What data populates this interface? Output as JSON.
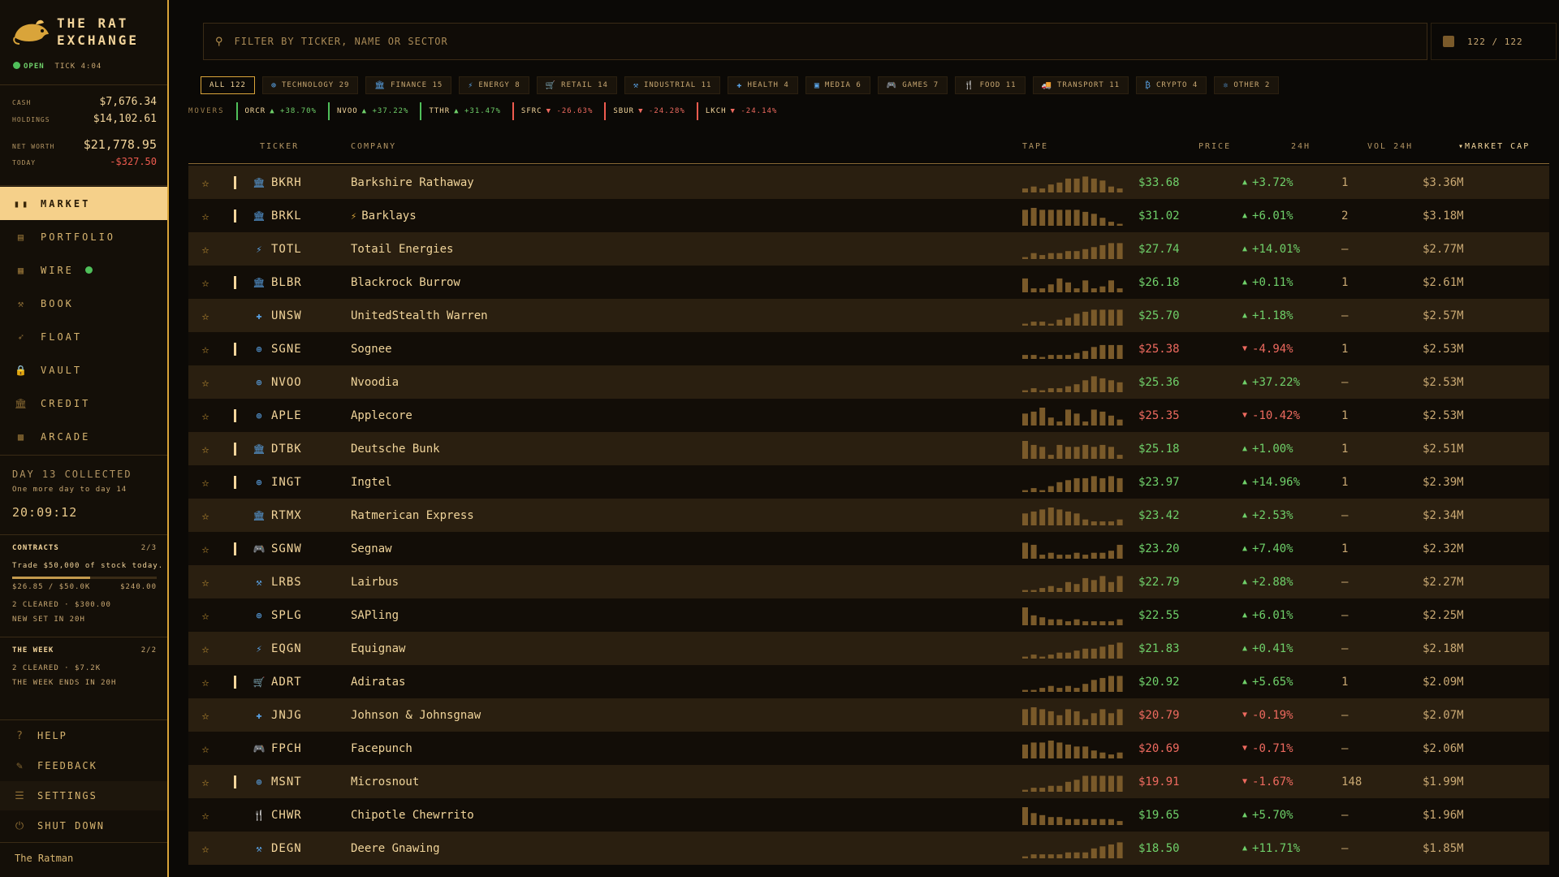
{
  "app": {
    "name_line1": "THE RAT",
    "name_line2": "EXCHANGE",
    "status": "OPEN",
    "tick": "TICK 4:04"
  },
  "account": {
    "cash_label": "CASH",
    "cash": "$7,676.34",
    "holdings_label": "HOLDINGS",
    "holdings": "$14,102.61",
    "net_worth_label": "NET WORTH",
    "net_worth": "$21,778.95",
    "today_label": "TODAY",
    "today": "-$327.50"
  },
  "nav": [
    {
      "label": "MARKET",
      "icon": "market-icon"
    },
    {
      "label": "PORTFOLIO",
      "icon": "portfolio-icon"
    },
    {
      "label": "WIRE",
      "icon": "wire-icon"
    },
    {
      "label": "BOOK",
      "icon": "gavel-icon"
    },
    {
      "label": "FLOAT",
      "icon": "rocket-icon"
    },
    {
      "label": "VAULT",
      "icon": "lock-icon"
    },
    {
      "label": "CREDIT",
      "icon": "bank-icon"
    },
    {
      "label": "ARCADE",
      "icon": "arcade-icon"
    }
  ],
  "daily": {
    "title": "DAY 13 COLLECTED",
    "subtitle": "One more day to day 14",
    "timer": "20:09:12"
  },
  "contracts": {
    "label": "CONTRACTS",
    "count": "2/3",
    "task": "Trade $50,000 of stock today.",
    "progress_text": "$26.85 / $50.0K",
    "reward": "$240.00",
    "progress": 0.537,
    "cleared": "2 CLEARED · $300.00",
    "new_set": "NEW SET IN 20H"
  },
  "week": {
    "label": "THE WEEK",
    "count": "2/2",
    "cleared": "2 CLEARED · $7.2K",
    "ends": "THE WEEK ENDS IN 20H"
  },
  "bottom_nav": [
    {
      "label": "HELP",
      "icon": "help-icon"
    },
    {
      "label": "FEEDBACK",
      "icon": "feedback-icon"
    },
    {
      "label": "SETTINGS",
      "icon": "settings-icon"
    },
    {
      "label": "SHUT DOWN",
      "icon": "power-icon"
    }
  ],
  "user": "The Ratman",
  "search": {
    "placeholder": "FILTER BY TICKER, NAME OR SECTOR",
    "count": "122 / 122"
  },
  "sectors": [
    {
      "label": "ALL 122",
      "icon": "",
      "active": true
    },
    {
      "label": "TECHNOLOGY 29",
      "icon": "⊕"
    },
    {
      "label": "FINANCE 15",
      "icon": "🏛"
    },
    {
      "label": "ENERGY 8",
      "icon": "⚡"
    },
    {
      "label": "RETAIL 14",
      "icon": "🛒"
    },
    {
      "label": "INDUSTRIAL 11",
      "icon": "⚒"
    },
    {
      "label": "HEALTH 4",
      "icon": "✚"
    },
    {
      "label": "MEDIA 6",
      "icon": "▣"
    },
    {
      "label": "GAMES 7",
      "icon": "🎮"
    },
    {
      "label": "FOOD 11",
      "icon": "🍴"
    },
    {
      "label": "TRANSPORT 11",
      "icon": "🚚"
    },
    {
      "label": "CRYPTO 4",
      "icon": "₿"
    },
    {
      "label": "OTHER 2",
      "icon": "⚛"
    }
  ],
  "movers_label": "MOVERS",
  "movers": [
    {
      "ticker": "ORCR",
      "change": "+38.70%",
      "dir": "up"
    },
    {
      "ticker": "NVOO",
      "change": "+37.22%",
      "dir": "up"
    },
    {
      "ticker": "TTHR",
      "change": "+31.47%",
      "dir": "up"
    },
    {
      "ticker": "SFRC",
      "change": "-26.63%",
      "dir": "down"
    },
    {
      "ticker": "SBUR",
      "change": "-24.28%",
      "dir": "down"
    },
    {
      "ticker": "LKCH",
      "change": "-24.14%",
      "dir": "down"
    }
  ],
  "columns": {
    "ticker": "TICKER",
    "company": "COMPANY",
    "tape": "TAPE",
    "price": "PRICE",
    "change": "24H",
    "volume": "VOL 24H",
    "market_cap": "▾MARKET CAP"
  },
  "stocks": [
    {
      "ticker": "BKRH",
      "company": "Barkshire Rathaway",
      "held": true,
      "sector_icon": "🏛",
      "price": "$33.68",
      "change": "+3.72%",
      "dir": "up",
      "vol": "1",
      "cap": "$3.36M",
      "tape": [
        2,
        3,
        2,
        4,
        5,
        7,
        7,
        8,
        7,
        6,
        3,
        2
      ]
    },
    {
      "ticker": "BRKL",
      "company": "Barklays",
      "held": true,
      "sector_icon": "🏛",
      "inline_icon": "⚡",
      "price": "$31.02",
      "change": "+6.01%",
      "dir": "up",
      "vol": "2",
      "cap": "$3.18M",
      "tape": [
        8,
        9,
        8,
        8,
        8,
        8,
        8,
        7,
        6,
        4,
        2,
        1
      ]
    },
    {
      "ticker": "TOTL",
      "company": "Totail Energies",
      "held": false,
      "sector_icon": "⚡",
      "price": "$27.74",
      "change": "+14.01%",
      "dir": "up",
      "vol": "—",
      "cap": "$2.77M",
      "tape": [
        1,
        3,
        2,
        3,
        3,
        4,
        4,
        5,
        6,
        7,
        8,
        8
      ]
    },
    {
      "ticker": "BLBR",
      "company": "Blackrock Burrow",
      "held": true,
      "sector_icon": "🏛",
      "price": "$26.18",
      "change": "+0.11%",
      "dir": "up",
      "vol": "1",
      "cap": "$2.61M",
      "tape": [
        7,
        2,
        2,
        4,
        7,
        5,
        2,
        6,
        2,
        3,
        6,
        2
      ]
    },
    {
      "ticker": "UNSW",
      "company": "UnitedStealth Warren",
      "held": false,
      "sector_icon": "✚",
      "price": "$25.70",
      "change": "+1.18%",
      "dir": "up",
      "vol": "—",
      "cap": "$2.57M",
      "tape": [
        1,
        2,
        2,
        1,
        3,
        4,
        6,
        7,
        8,
        8,
        8,
        8
      ]
    },
    {
      "ticker": "SGNE",
      "company": "Sognee",
      "held": true,
      "sector_icon": "⊕",
      "price": "$25.38",
      "change": "-4.94%",
      "dir": "down",
      "vol": "1",
      "cap": "$2.53M",
      "tape": [
        2,
        2,
        1,
        2,
        2,
        2,
        3,
        4,
        6,
        7,
        7,
        7
      ]
    },
    {
      "ticker": "NVOO",
      "company": "Nvoodia",
      "held": false,
      "sector_icon": "⊕",
      "price": "$25.36",
      "change": "+37.22%",
      "dir": "up",
      "vol": "—",
      "cap": "$2.53M",
      "tape": [
        1,
        2,
        1,
        2,
        2,
        3,
        4,
        6,
        8,
        7,
        6,
        5
      ]
    },
    {
      "ticker": "APLE",
      "company": "Applecore",
      "held": true,
      "sector_icon": "⊕",
      "price": "$25.35",
      "change": "-10.42%",
      "dir": "down",
      "vol": "1",
      "cap": "$2.53M",
      "tape": [
        6,
        7,
        9,
        4,
        2,
        8,
        6,
        2,
        8,
        7,
        5,
        3
      ]
    },
    {
      "ticker": "DTBK",
      "company": "Deutsche Bunk",
      "held": true,
      "sector_icon": "🏛",
      "price": "$25.18",
      "change": "+1.00%",
      "dir": "up",
      "vol": "1",
      "cap": "$2.51M",
      "tape": [
        9,
        7,
        6,
        2,
        7,
        6,
        6,
        7,
        6,
        7,
        6,
        2
      ]
    },
    {
      "ticker": "INGT",
      "company": "Ingtel",
      "held": true,
      "sector_icon": "⊕",
      "price": "$23.97",
      "change": "+14.96%",
      "dir": "up",
      "vol": "1",
      "cap": "$2.39M",
      "tape": [
        1,
        2,
        1,
        3,
        5,
        6,
        7,
        7,
        8,
        7,
        8,
        7
      ]
    },
    {
      "ticker": "RTMX",
      "company": "Ratmerican Express",
      "held": false,
      "sector_icon": "🏛",
      "price": "$23.42",
      "change": "+2.53%",
      "dir": "up",
      "vol": "—",
      "cap": "$2.34M",
      "tape": [
        6,
        7,
        8,
        9,
        8,
        7,
        6,
        3,
        2,
        2,
        2,
        3
      ]
    },
    {
      "ticker": "SGNW",
      "company": "Segnaw",
      "held": true,
      "sector_icon": "🎮",
      "price": "$23.20",
      "change": "+7.40%",
      "dir": "up",
      "vol": "1",
      "cap": "$2.32M",
      "tape": [
        8,
        7,
        2,
        3,
        2,
        2,
        3,
        2,
        3,
        3,
        4,
        7
      ]
    },
    {
      "ticker": "LRBS",
      "company": "Lairbus",
      "held": false,
      "sector_icon": "⚒",
      "price": "$22.79",
      "change": "+2.88%",
      "dir": "up",
      "vol": "—",
      "cap": "$2.27M",
      "tape": [
        1,
        1,
        2,
        3,
        2,
        5,
        4,
        7,
        6,
        8,
        5,
        8
      ]
    },
    {
      "ticker": "SPLG",
      "company": "SAPling",
      "held": false,
      "sector_icon": "⊕",
      "price": "$22.55",
      "change": "+6.01%",
      "dir": "up",
      "vol": "—",
      "cap": "$2.25M",
      "tape": [
        9,
        5,
        4,
        3,
        3,
        2,
        3,
        2,
        2,
        2,
        2,
        3
      ]
    },
    {
      "ticker": "EQGN",
      "company": "Equignaw",
      "held": false,
      "sector_icon": "⚡",
      "price": "$21.83",
      "change": "+0.41%",
      "dir": "up",
      "vol": "—",
      "cap": "$2.18M",
      "tape": [
        1,
        2,
        1,
        2,
        3,
        3,
        4,
        5,
        5,
        6,
        7,
        8
      ]
    },
    {
      "ticker": "ADRT",
      "company": "Adiratas",
      "held": true,
      "sector_icon": "🛒",
      "price": "$20.92",
      "change": "+5.65%",
      "dir": "up",
      "vol": "1",
      "cap": "$2.09M",
      "tape": [
        1,
        1,
        2,
        3,
        2,
        3,
        2,
        4,
        6,
        7,
        8,
        8
      ]
    },
    {
      "ticker": "JNJG",
      "company": "Johnson & Johnsgnaw",
      "held": false,
      "sector_icon": "✚",
      "price": "$20.79",
      "change": "-0.19%",
      "dir": "down",
      "vol": "—",
      "cap": "$2.07M",
      "tape": [
        8,
        9,
        8,
        7,
        5,
        8,
        7,
        3,
        6,
        8,
        6,
        8
      ]
    },
    {
      "ticker": "FPCH",
      "company": "Facepunch",
      "held": false,
      "sector_icon": "🎮",
      "price": "$20.69",
      "change": "-0.71%",
      "dir": "down",
      "vol": "—",
      "cap": "$2.06M",
      "tape": [
        7,
        8,
        8,
        9,
        8,
        7,
        6,
        6,
        4,
        3,
        2,
        3
      ]
    },
    {
      "ticker": "MSNT",
      "company": "Microsnout",
      "held": true,
      "sector_icon": "⊕",
      "price": "$19.91",
      "change": "-1.67%",
      "dir": "down",
      "vol": "148",
      "cap": "$1.99M",
      "tape": [
        1,
        2,
        2,
        3,
        3,
        5,
        6,
        8,
        8,
        8,
        8,
        8
      ]
    },
    {
      "ticker": "CHWR",
      "company": "Chipotle Chewrrito",
      "held": false,
      "sector_icon": "🍴",
      "price": "$19.65",
      "change": "+5.70%",
      "dir": "up",
      "vol": "—",
      "cap": "$1.96M",
      "tape": [
        9,
        6,
        5,
        4,
        4,
        3,
        3,
        3,
        3,
        3,
        3,
        2
      ]
    },
    {
      "ticker": "DEGN",
      "company": "Deere Gnawing",
      "held": false,
      "sector_icon": "⚒",
      "price": "$18.50",
      "change": "+11.71%",
      "dir": "up",
      "vol": "—",
      "cap": "$1.85M",
      "tape": [
        1,
        2,
        2,
        2,
        2,
        3,
        3,
        3,
        5,
        6,
        7,
        8
      ]
    }
  ]
}
